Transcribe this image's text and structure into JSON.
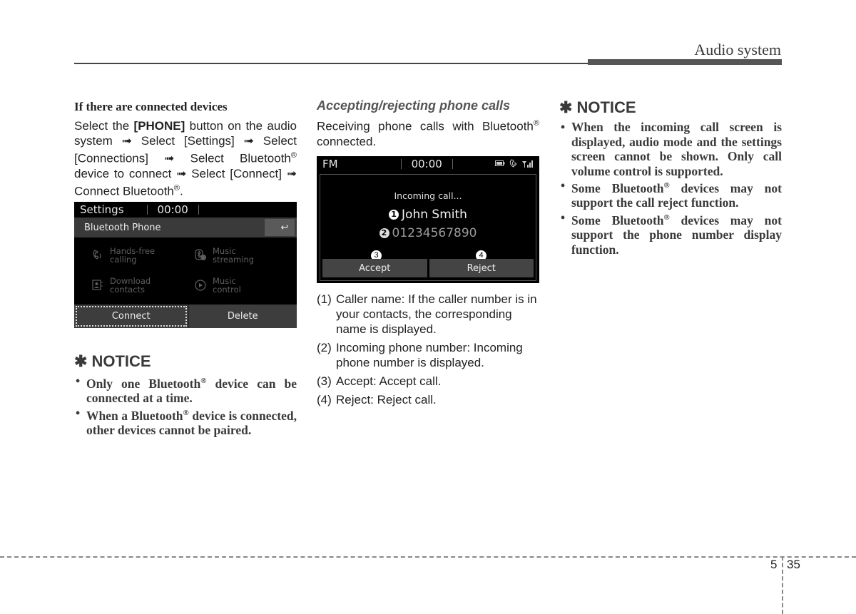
{
  "header": {
    "section_title": "Audio system"
  },
  "col1": {
    "subheading": "If there are connected devices",
    "para": {
      "p1": "Select the ",
      "phone_btn": "[PHONE]",
      "p2": " button on the audio system ➟ Select [Settings] ➟ Select [Connections] ➟ Select Bluetooth",
      "reg": "®",
      "p3": " device to connect ➟ Select [Connect] ➟ Connect Bluetooth",
      "p4": "."
    },
    "screen": {
      "title": "Settings",
      "clock": "00:00",
      "subtitle": "Bluetooth Phone",
      "back_icon": "↩",
      "menu": [
        {
          "icon": "handsfree-icon",
          "line1": "Hands-free",
          "line2": "calling"
        },
        {
          "icon": "music-streaming-icon",
          "line1": "Music",
          "line2": "streaming"
        },
        {
          "icon": "download-contacts-icon",
          "line1": "Download",
          "line2": "contacts"
        },
        {
          "icon": "music-control-icon",
          "line1": "Music",
          "line2": "control"
        }
      ],
      "buttons": {
        "connect": "Connect",
        "delete": "Delete"
      }
    },
    "notice": {
      "asterisk": "✱",
      "title": "NOTICE",
      "items": [
        {
          "a": "Only one Bluetooth",
          "reg": "®",
          "b": " device can be connected at a time."
        },
        {
          "a": "When a Bluetooth",
          "reg": "®",
          "b": " device is connected, other devices cannot be paired."
        }
      ]
    }
  },
  "col2": {
    "heading": "Accepting/rejecting phone calls",
    "intro_a": "Receiving phone calls with Bluetooth",
    "reg": "®",
    "intro_b": " connected.",
    "screen": {
      "source": "FM",
      "clock": "00:00",
      "status_icons": [
        "battery-icon",
        "bluetooth-phone-icon",
        "signal-icon"
      ],
      "incoming_label": "Incoming call...",
      "caller_name": "John Smith",
      "caller_number": "01234567890",
      "markers": [
        "1",
        "2",
        "3",
        "4"
      ],
      "buttons": {
        "accept": "Accept",
        "reject": "Reject"
      }
    },
    "descriptions": [
      {
        "num": "(1)",
        "text": "Caller name: If the caller number is in your contacts, the correspon­ding name is displayed."
      },
      {
        "num": "(2)",
        "text": "Incoming phone number: Incoming phone number is displayed."
      },
      {
        "num": "(3)",
        "text": "Accept: Accept call."
      },
      {
        "num": "(4)",
        "text": "Reject: Reject call."
      }
    ]
  },
  "col3": {
    "notice": {
      "asterisk": "✱",
      "title": "NOTICE",
      "items": [
        {
          "a": "When the incoming call screen is displayed, audio mode and the settings screen cannot be shown. Only call volume control is supported.",
          "reg": "",
          "b": ""
        },
        {
          "a": "Some Bluetooth",
          "reg": "®",
          "b": " devices may not support the call reject function."
        },
        {
          "a": "Some Bluetooth",
          "reg": "®",
          "b": " devices may not support the phone number display function."
        }
      ]
    }
  },
  "footer": {
    "section": "5",
    "page": "35"
  }
}
